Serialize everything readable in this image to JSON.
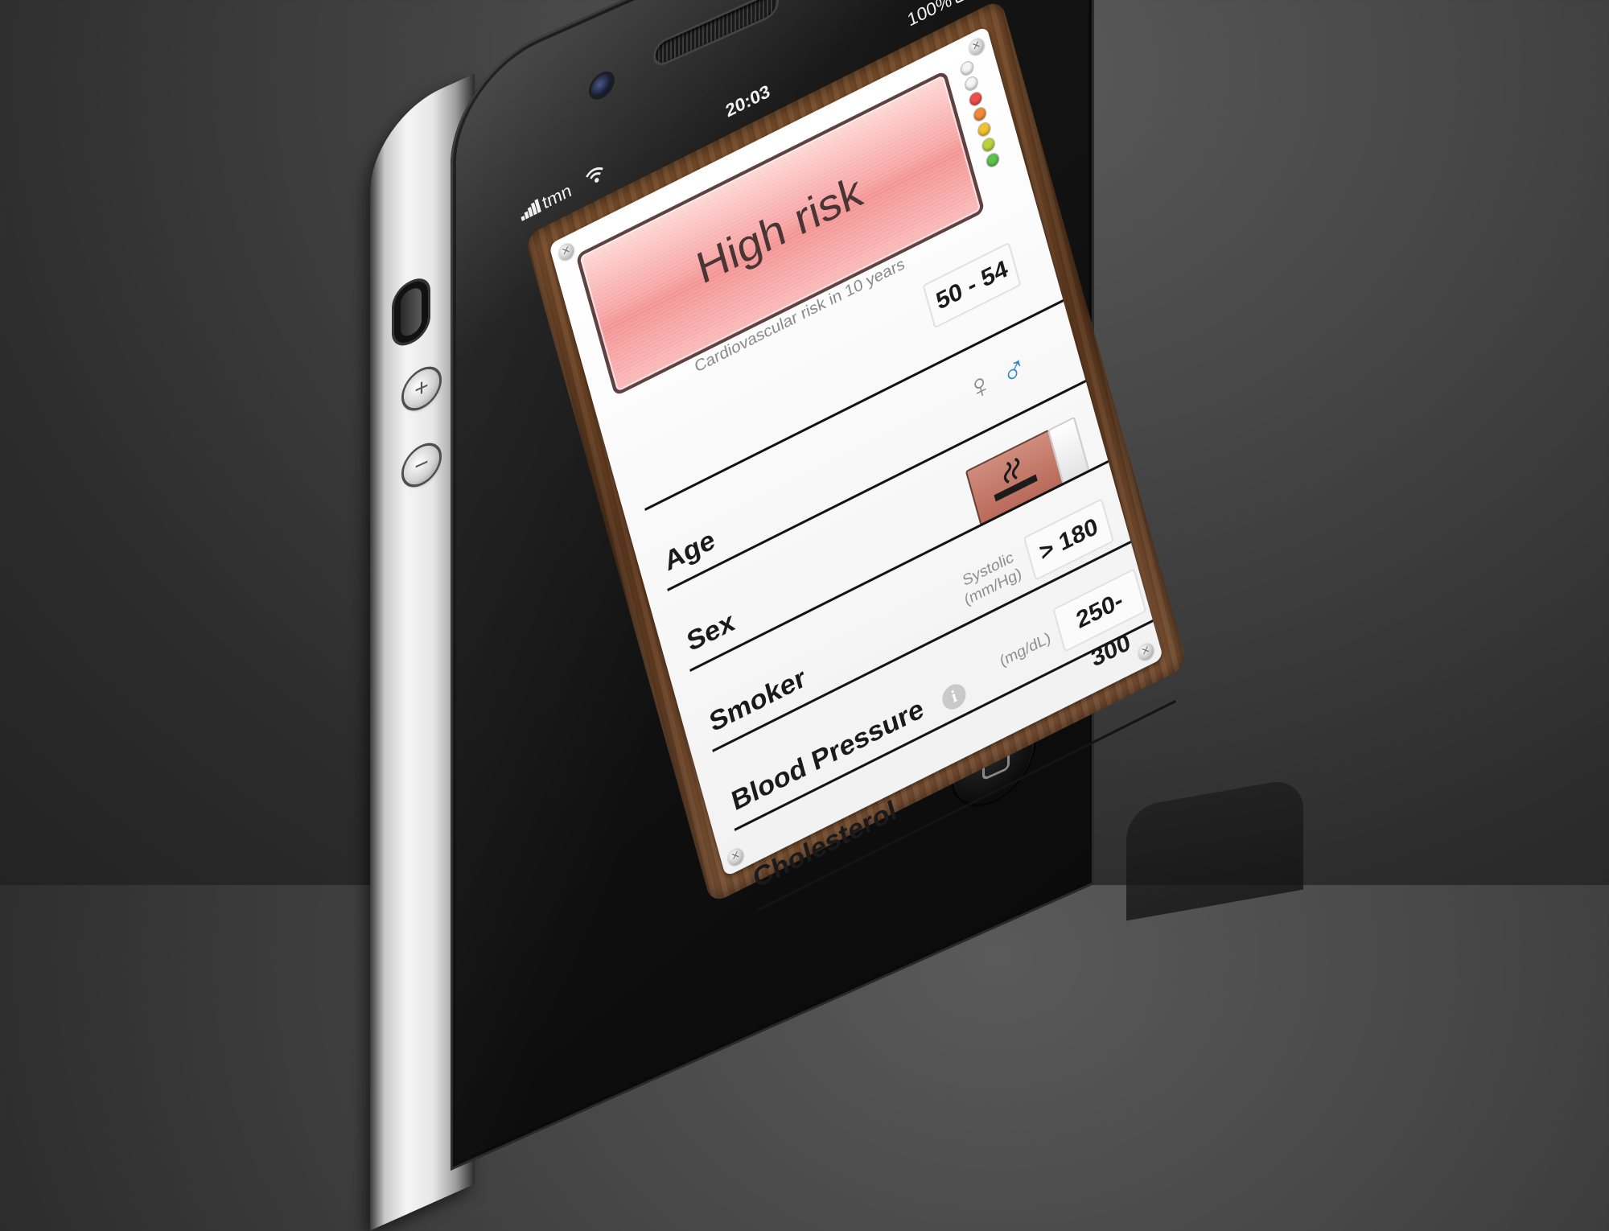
{
  "status_bar": {
    "carrier": "tmn",
    "time": "20:03",
    "battery_percent": "100%",
    "signal_icon": "signal-bars-icon",
    "wifi_icon": "wifi-icon",
    "battery_icon": "battery-icon"
  },
  "risk": {
    "label": "High risk",
    "caption": "Cardiovascular risk in 10 years",
    "color": "#f39393",
    "indicator_lights": [
      "#f5f5f5",
      "#f5f5f5",
      "#ee4d4d",
      "#f08a3a",
      "#f2c230",
      "#b9d23c",
      "#5cc34d"
    ]
  },
  "fields": [
    {
      "label": "Age",
      "value": "50 - 54"
    },
    {
      "label": "Sex",
      "female_symbol": "♀",
      "male_symbol": "♂",
      "selected": "male"
    },
    {
      "label": "Smoker",
      "icon": "cigarette-icon",
      "state": "on"
    },
    {
      "label": "Blood Pressure",
      "unit": "Systolic (mm/Hg)",
      "value": "> 180"
    },
    {
      "label": "Cholesterol",
      "unit": "(mg/dL)",
      "value": "250-300"
    }
  ],
  "info_button": "i",
  "colors": {
    "male_blue": "#2f86c9",
    "female_gray": "#8a8a8a",
    "smoker_active": "#c2766a"
  }
}
